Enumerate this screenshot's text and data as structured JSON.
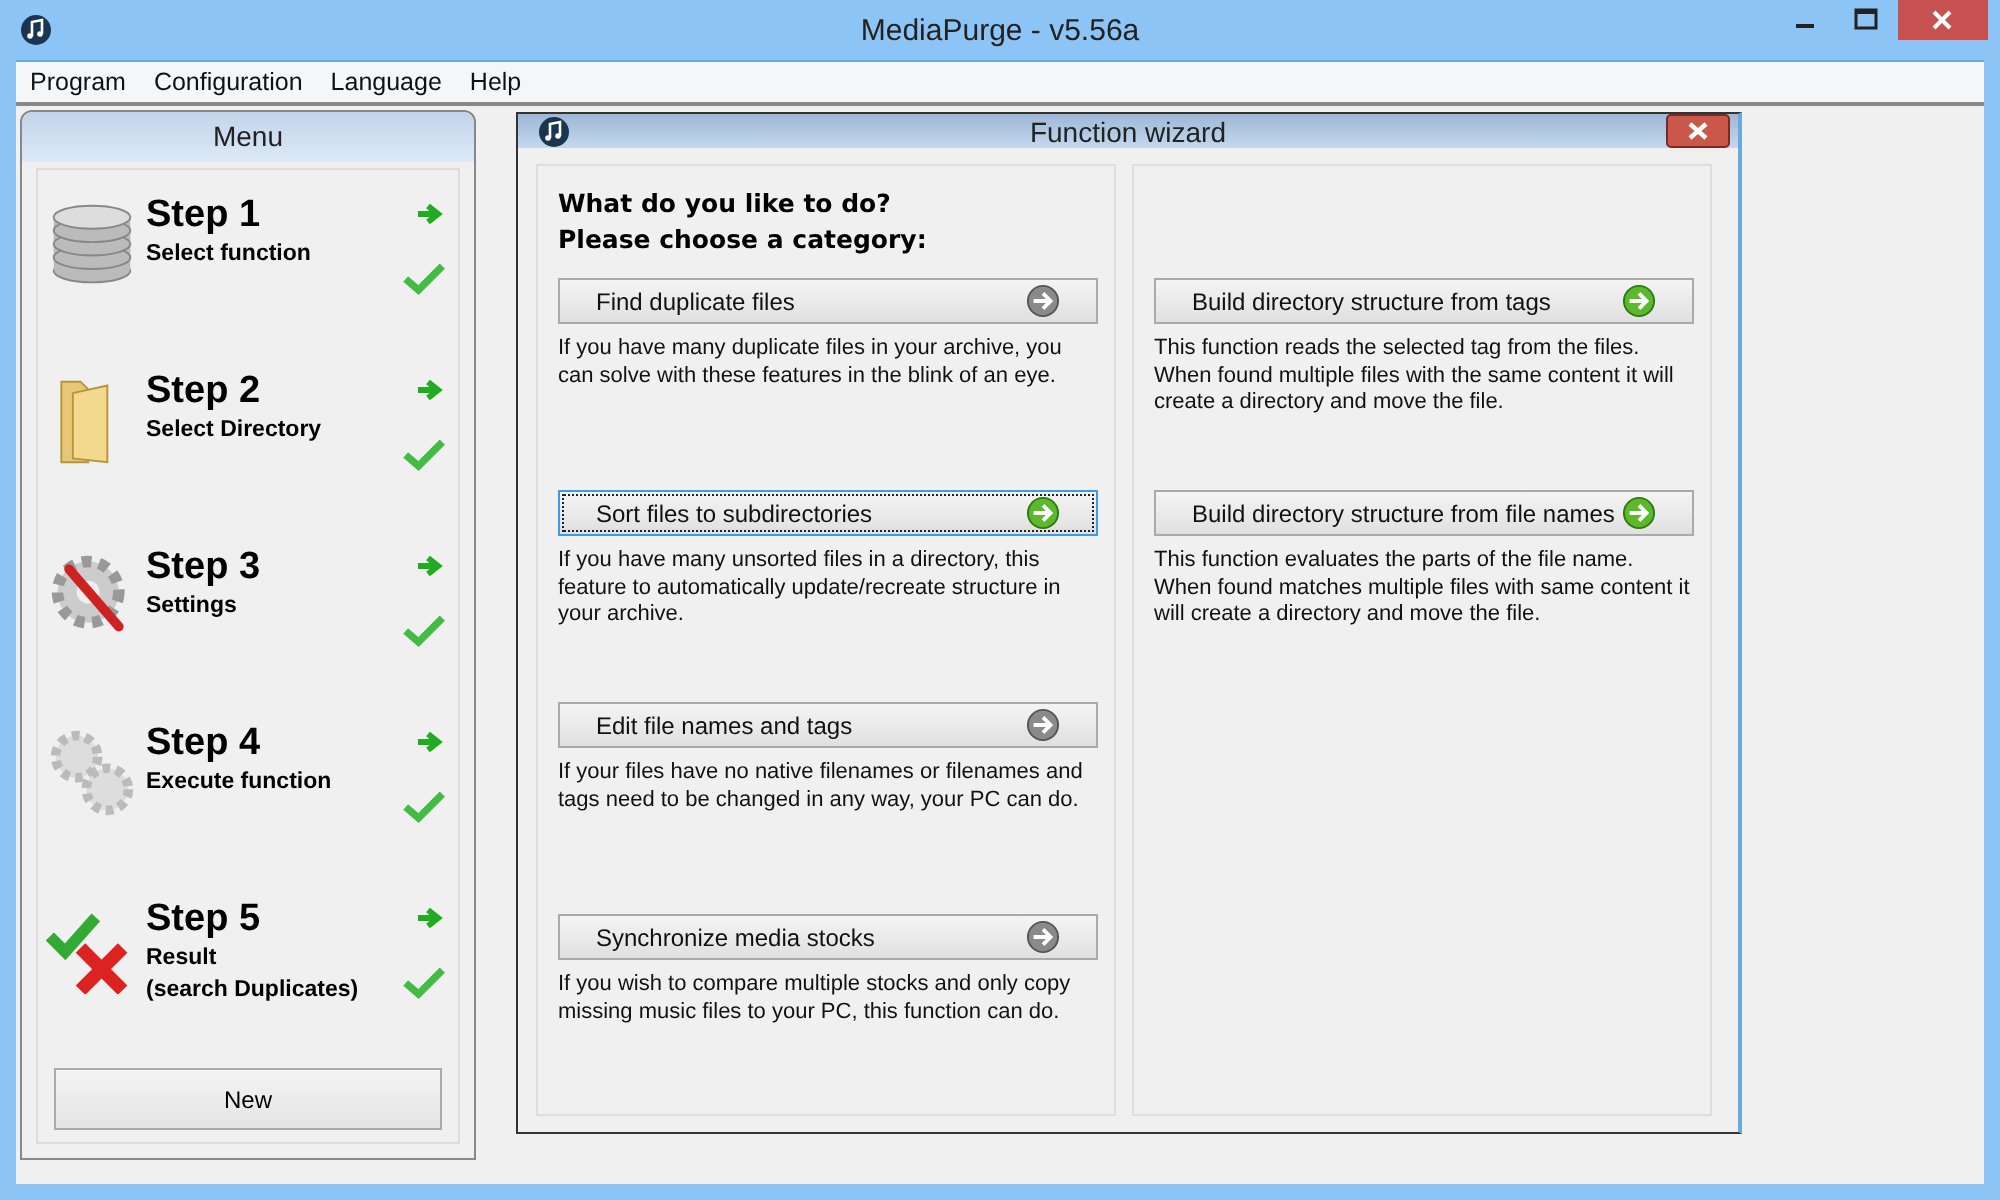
{
  "window": {
    "title": "MediaPurge - v5.56a"
  },
  "menu_bar": [
    "Program",
    "Configuration",
    "Language",
    "Help"
  ],
  "sidebar": {
    "title": "Menu",
    "steps": [
      {
        "title": "Step 1",
        "subtitle": [
          "Select function"
        ],
        "kind": "database",
        "done": true
      },
      {
        "title": "Step 2",
        "subtitle": [
          "Select Directory"
        ],
        "kind": "folder",
        "done": true
      },
      {
        "title": "Step 3",
        "subtitle": [
          "Settings"
        ],
        "kind": "tools",
        "done": true
      },
      {
        "title": "Step 4",
        "subtitle": [
          "Execute function"
        ],
        "kind": "gears",
        "done": true
      },
      {
        "title": "Step 5",
        "subtitle": [
          "Result",
          "(search Duplicates)"
        ],
        "kind": "result",
        "done": true
      }
    ],
    "button": "New"
  },
  "wizard": {
    "title": "Function wizard",
    "heading": [
      "What do you like to do?",
      "Please choose a category:"
    ],
    "columns": [
      [
        {
          "label": "Find duplicate files",
          "selected": false,
          "available": false,
          "description": "If you have many duplicate files in your archive, you can solve with these features in the blink of an eye."
        },
        {
          "label": "Sort files to subdirectories",
          "selected": true,
          "available": true,
          "description": "If you have many unsorted files in a directory, this feature to automatically update/recreate structure in your archive."
        },
        {
          "label": "Edit file names and tags",
          "selected": false,
          "available": false,
          "description": "If your files have no native filenames or filenames and tags need to be changed in any way, your PC can do."
        },
        {
          "label": "Synchronize media stocks",
          "selected": false,
          "available": false,
          "description": "If you wish to compare multiple stocks and only copy missing music files to your PC, this function can do."
        }
      ],
      [
        {
          "label": "Build directory structure from tags",
          "selected": false,
          "available": true,
          "description": "This function reads the selected tag from the files. When found multiple files with the same content it will create a directory and move the file."
        },
        {
          "label": "Build directory structure from file names",
          "selected": false,
          "available": true,
          "description": "This function evaluates the parts of the file name. When found matches multiple files with same content it will create a directory and move the file."
        }
      ]
    ]
  }
}
